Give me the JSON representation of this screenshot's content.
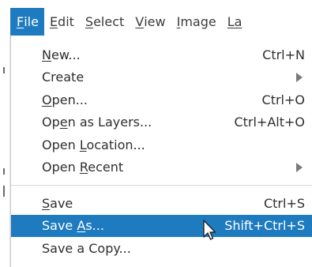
{
  "menubar": {
    "items": [
      {
        "pre": "",
        "mn": "F",
        "post": "ile"
      },
      {
        "pre": "",
        "mn": "E",
        "post": "dit"
      },
      {
        "pre": "",
        "mn": "S",
        "post": "elect"
      },
      {
        "pre": "",
        "mn": "V",
        "post": "iew"
      },
      {
        "pre": "",
        "mn": "I",
        "post": "mage"
      },
      {
        "pre": "",
        "mn": "La",
        "post": ""
      }
    ]
  },
  "file_menu": {
    "new": {
      "pre": "",
      "mn": "N",
      "post": "ew...",
      "accel": "Ctrl+N"
    },
    "create": {
      "pre": "Create",
      "mn": "",
      "post": ""
    },
    "open": {
      "pre": "",
      "mn": "O",
      "post": "pen...",
      "accel": "Ctrl+O"
    },
    "open_as_layers": {
      "pre": "Op",
      "mn": "e",
      "post": "n as Layers...",
      "accel": "Ctrl+Alt+O"
    },
    "open_location": {
      "pre": "Open ",
      "mn": "L",
      "post": "ocation..."
    },
    "open_recent": {
      "pre": "Open ",
      "mn": "R",
      "post": "ecent"
    },
    "save": {
      "pre": "",
      "mn": "S",
      "post": "ave",
      "accel": "Ctrl+S"
    },
    "save_as": {
      "pre": "Save ",
      "mn": "A",
      "post": "s...",
      "accel": "Shift+Ctrl+S"
    },
    "save_copy": {
      "pre": "Save a Copy...",
      "mn": "",
      "post": ""
    }
  },
  "colors": {
    "highlight": "#1f7bc0",
    "submenu_arrow": "#7a7a7a"
  },
  "icons": [
    "submenu-arrow-icon",
    "mouse-pointer-icon"
  ]
}
